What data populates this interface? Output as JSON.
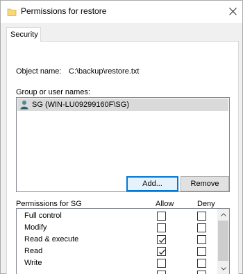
{
  "window": {
    "title": "Permissions for restore"
  },
  "tabs": [
    {
      "label": "Security"
    }
  ],
  "object": {
    "label": "Object name:",
    "value": "C:\\backup\\restore.txt"
  },
  "group": {
    "label": "Group or user names:",
    "items": [
      {
        "label": "SG (WIN-LU09299160F\\SG)",
        "icon": "user-icon",
        "selected": true
      }
    ]
  },
  "buttons": {
    "add": "Add...",
    "remove": "Remove"
  },
  "permissions": {
    "header": "Permissions for SG",
    "allow_label": "Allow",
    "deny_label": "Deny",
    "rows": [
      {
        "name": "Full control",
        "allow": false,
        "deny": false
      },
      {
        "name": "Modify",
        "allow": false,
        "deny": false
      },
      {
        "name": "Read & execute",
        "allow": true,
        "deny": false
      },
      {
        "name": "Read",
        "allow": true,
        "deny": false
      },
      {
        "name": "Write",
        "allow": false,
        "deny": false
      }
    ]
  },
  "colors": {
    "accent": "#0078d7",
    "selection": "#dadada",
    "folder": "#f8d775"
  }
}
